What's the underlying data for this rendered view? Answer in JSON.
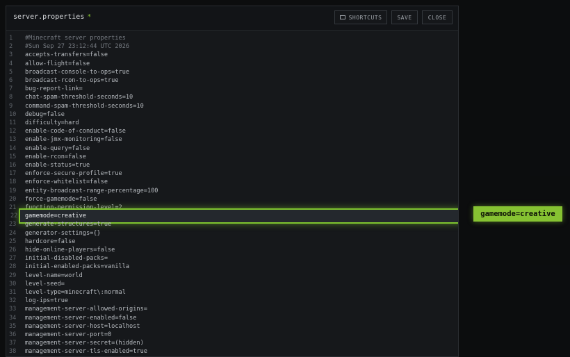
{
  "header": {
    "file_name": "server.properties",
    "dirty_marker": "*",
    "shortcuts_label": "SHORTCUTS",
    "save_label": "SAVE",
    "close_label": "CLOSE"
  },
  "editor": {
    "lines": [
      {
        "n": "1",
        "text": "#Minecraft server properties",
        "comment": true
      },
      {
        "n": "2",
        "text": "#Sun Sep 27 23:12:44 UTC 2026",
        "comment": true
      },
      {
        "n": "3",
        "text": "accepts-transfers=false"
      },
      {
        "n": "4",
        "text": "allow-flight=false"
      },
      {
        "n": "5",
        "text": "broadcast-console-to-ops=true"
      },
      {
        "n": "6",
        "text": "broadcast-rcon-to-ops=true"
      },
      {
        "n": "7",
        "text": "bug-report-link="
      },
      {
        "n": "8",
        "text": "chat-spam-threshold-seconds=10"
      },
      {
        "n": "9",
        "text": "command-spam-threshold-seconds=10"
      },
      {
        "n": "10",
        "text": "debug=false"
      },
      {
        "n": "11",
        "text": "difficulty=hard"
      },
      {
        "n": "12",
        "text": "enable-code-of-conduct=false"
      },
      {
        "n": "13",
        "text": "enable-jmx-monitoring=false"
      },
      {
        "n": "14",
        "text": "enable-query=false"
      },
      {
        "n": "15",
        "text": "enable-rcon=false"
      },
      {
        "n": "16",
        "text": "enable-status=true"
      },
      {
        "n": "17",
        "text": "enforce-secure-profile=true"
      },
      {
        "n": "18",
        "text": "enforce-whitelist=false"
      },
      {
        "n": "19",
        "text": "entity-broadcast-range-percentage=100"
      },
      {
        "n": "20",
        "text": "force-gamemode=false"
      },
      {
        "n": "21",
        "text": "function-permission-level=2"
      },
      {
        "n": "22",
        "text": "gamemode=creative",
        "highlighted": true
      },
      {
        "n": "23",
        "text": "generate-structures=true"
      },
      {
        "n": "24",
        "text": "generator-settings={}"
      },
      {
        "n": "25",
        "text": "hardcore=false"
      },
      {
        "n": "26",
        "text": "hide-online-players=false"
      },
      {
        "n": "27",
        "text": "initial-disabled-packs="
      },
      {
        "n": "28",
        "text": "initial-enabled-packs=vanilla"
      },
      {
        "n": "29",
        "text": "level-name=world"
      },
      {
        "n": "30",
        "text": "level-seed="
      },
      {
        "n": "31",
        "text": "level-type=minecraft\\:normal"
      },
      {
        "n": "32",
        "text": "log-ips=true"
      },
      {
        "n": "33",
        "text": "management-server-allowed-origins="
      },
      {
        "n": "34",
        "text": "management-server-enabled=false"
      },
      {
        "n": "35",
        "text": "management-server-host=localhost"
      },
      {
        "n": "36",
        "text": "management-server-port=0"
      },
      {
        "n": "37",
        "text": "management-server-secret=(hidden)"
      },
      {
        "n": "38",
        "text": "management-server-tls-enabled=true"
      }
    ]
  },
  "callout": {
    "text": "gamemode=creative"
  },
  "colors": {
    "accent": "#86c232",
    "background": "#16181b"
  }
}
